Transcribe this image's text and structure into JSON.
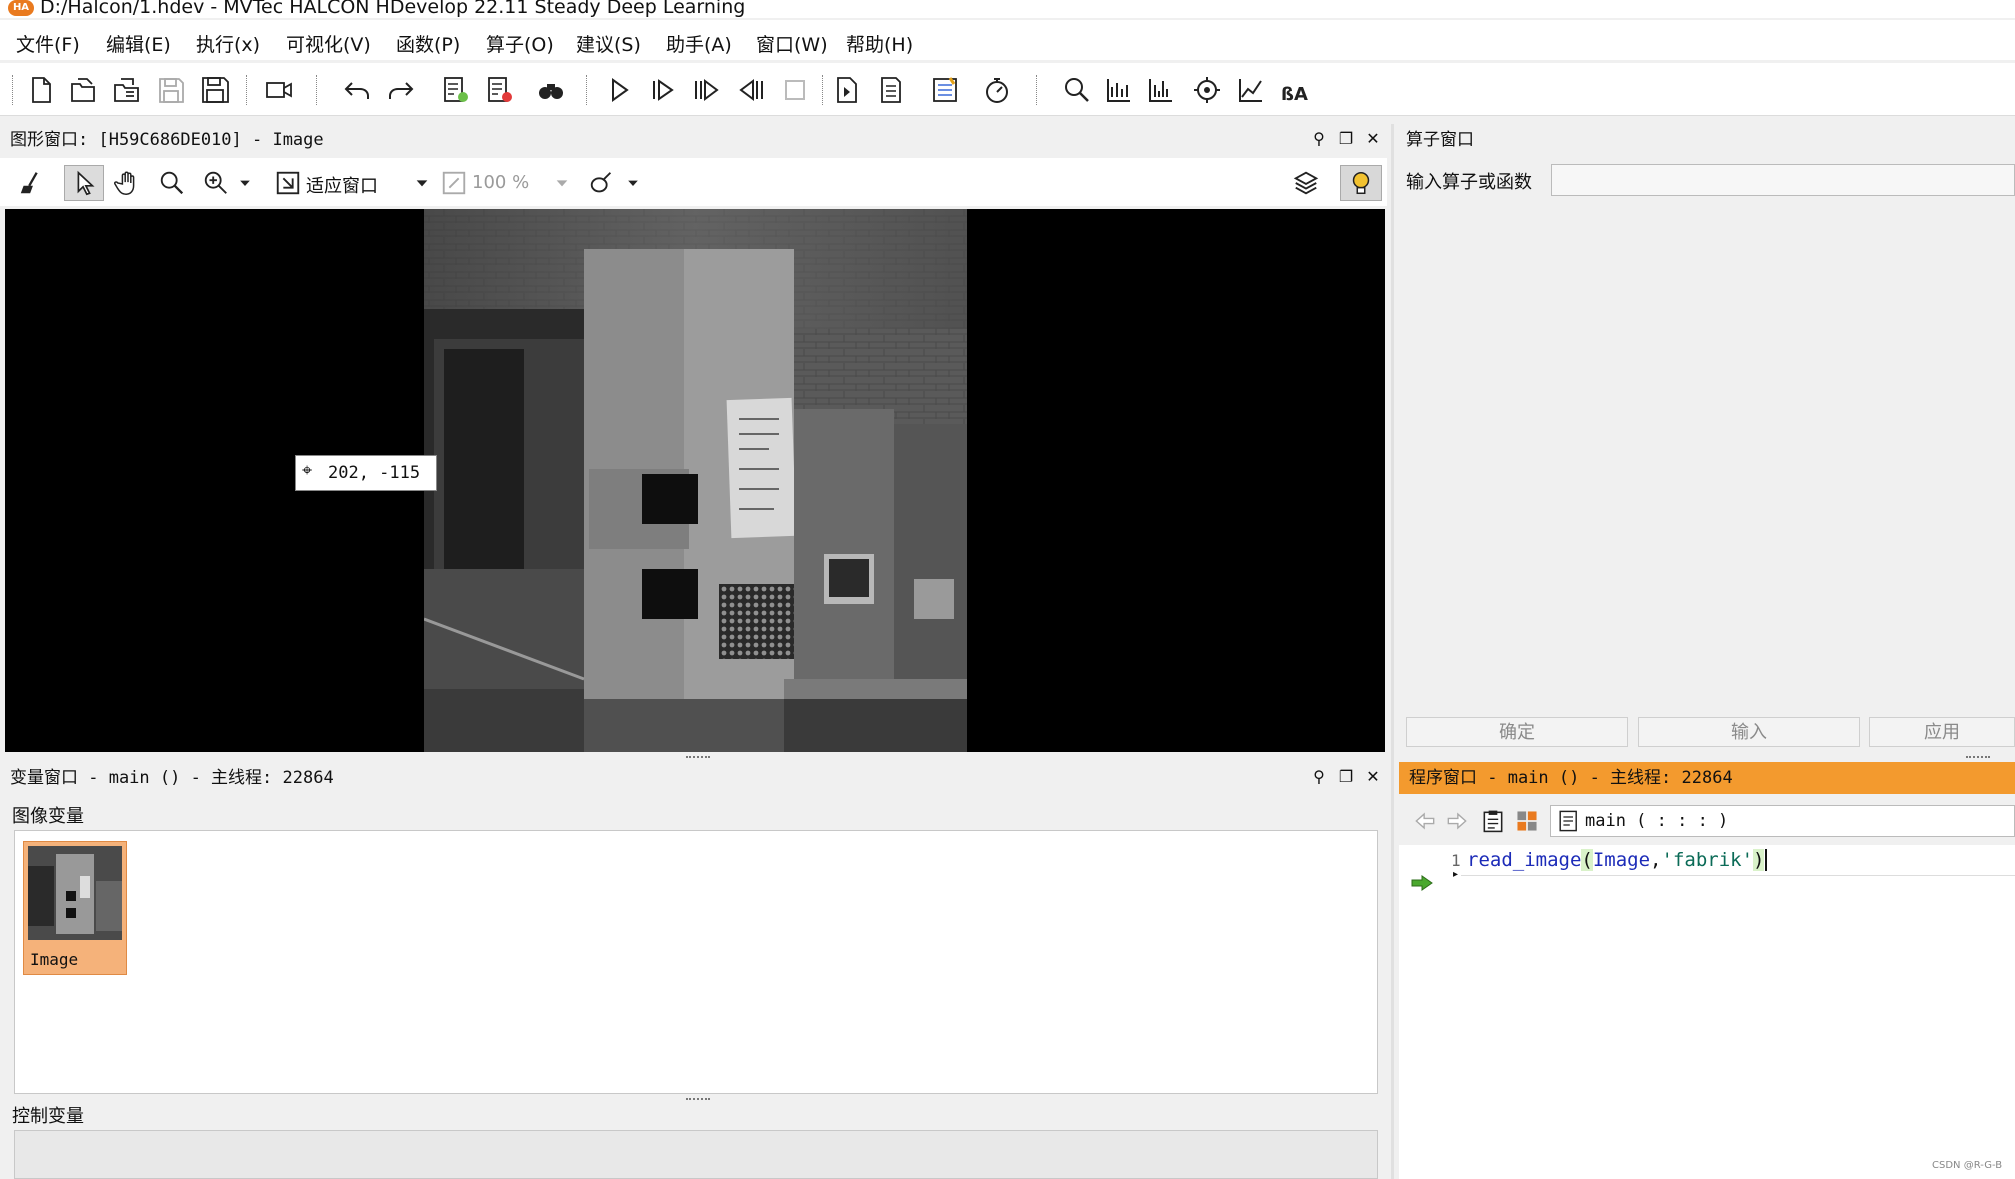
{
  "window": {
    "title": "D:/Halcon/1.hdev - MVTec HALCON HDevelop 22.11 Steady Deep Learning",
    "logo": "HA"
  },
  "menu": [
    "文件(F)",
    "编辑(E)",
    "执行(x)",
    "可视化(V)",
    "函数(P)",
    "算子(O)",
    "建议(S)",
    "助手(A)",
    "窗口(W)",
    "帮助(H)"
  ],
  "toolbar": {
    "icons": [
      "new-file-icon",
      "open-file-icon",
      "open-examples-icon",
      "save-icon",
      "save-all-icon",
      "record-icon",
      "undo-icon",
      "redo-icon",
      "activate-icon",
      "deactivate-icon",
      "find-icon",
      "run-icon",
      "step-over-icon",
      "step-forward-icon",
      "step-back-icon",
      "stop-icon",
      "insert-icon",
      "list-icon",
      "breakpoint-icon",
      "timer-icon",
      "zoom-icon",
      "histogram-icon",
      "line-profile-icon",
      "gray-icon",
      "feature-icon",
      "text-icon"
    ]
  },
  "graphics_window": {
    "title": "图形窗口: [H59C686DE010] - Image",
    "fit_label": "适应窗口",
    "zoom_value": "100 %",
    "coord_readout": "202, -115"
  },
  "operator_window": {
    "title": "算子窗口",
    "input_label": "输入算子或函数",
    "input_value": "",
    "buttons": [
      "确定",
      "输入",
      "应用"
    ]
  },
  "variable_window": {
    "title": "变量窗口 - main () - 主线程: 22864",
    "iconic_label": "图像变量",
    "control_label": "控制变量",
    "iconic_vars": [
      {
        "name": "Image"
      }
    ]
  },
  "program_window": {
    "title": "程序窗口 - main () - 主线程: 22864",
    "procedure": "main ( : : : )",
    "lines": [
      {
        "number": "1",
        "code_parts": [
          "read_image",
          "(",
          "Image",
          ",",
          "'fabrik'",
          ")"
        ]
      }
    ]
  },
  "watermark": "CSDN @R-G-B",
  "colors": {
    "accent_orange": "#f39a2e",
    "selection_orange": "#f5b27a",
    "code_blue": "#1c2bb8",
    "code_string": "#0b6b57",
    "paren_green": "#d9f2c9",
    "lightbulb": "#f2c230"
  }
}
